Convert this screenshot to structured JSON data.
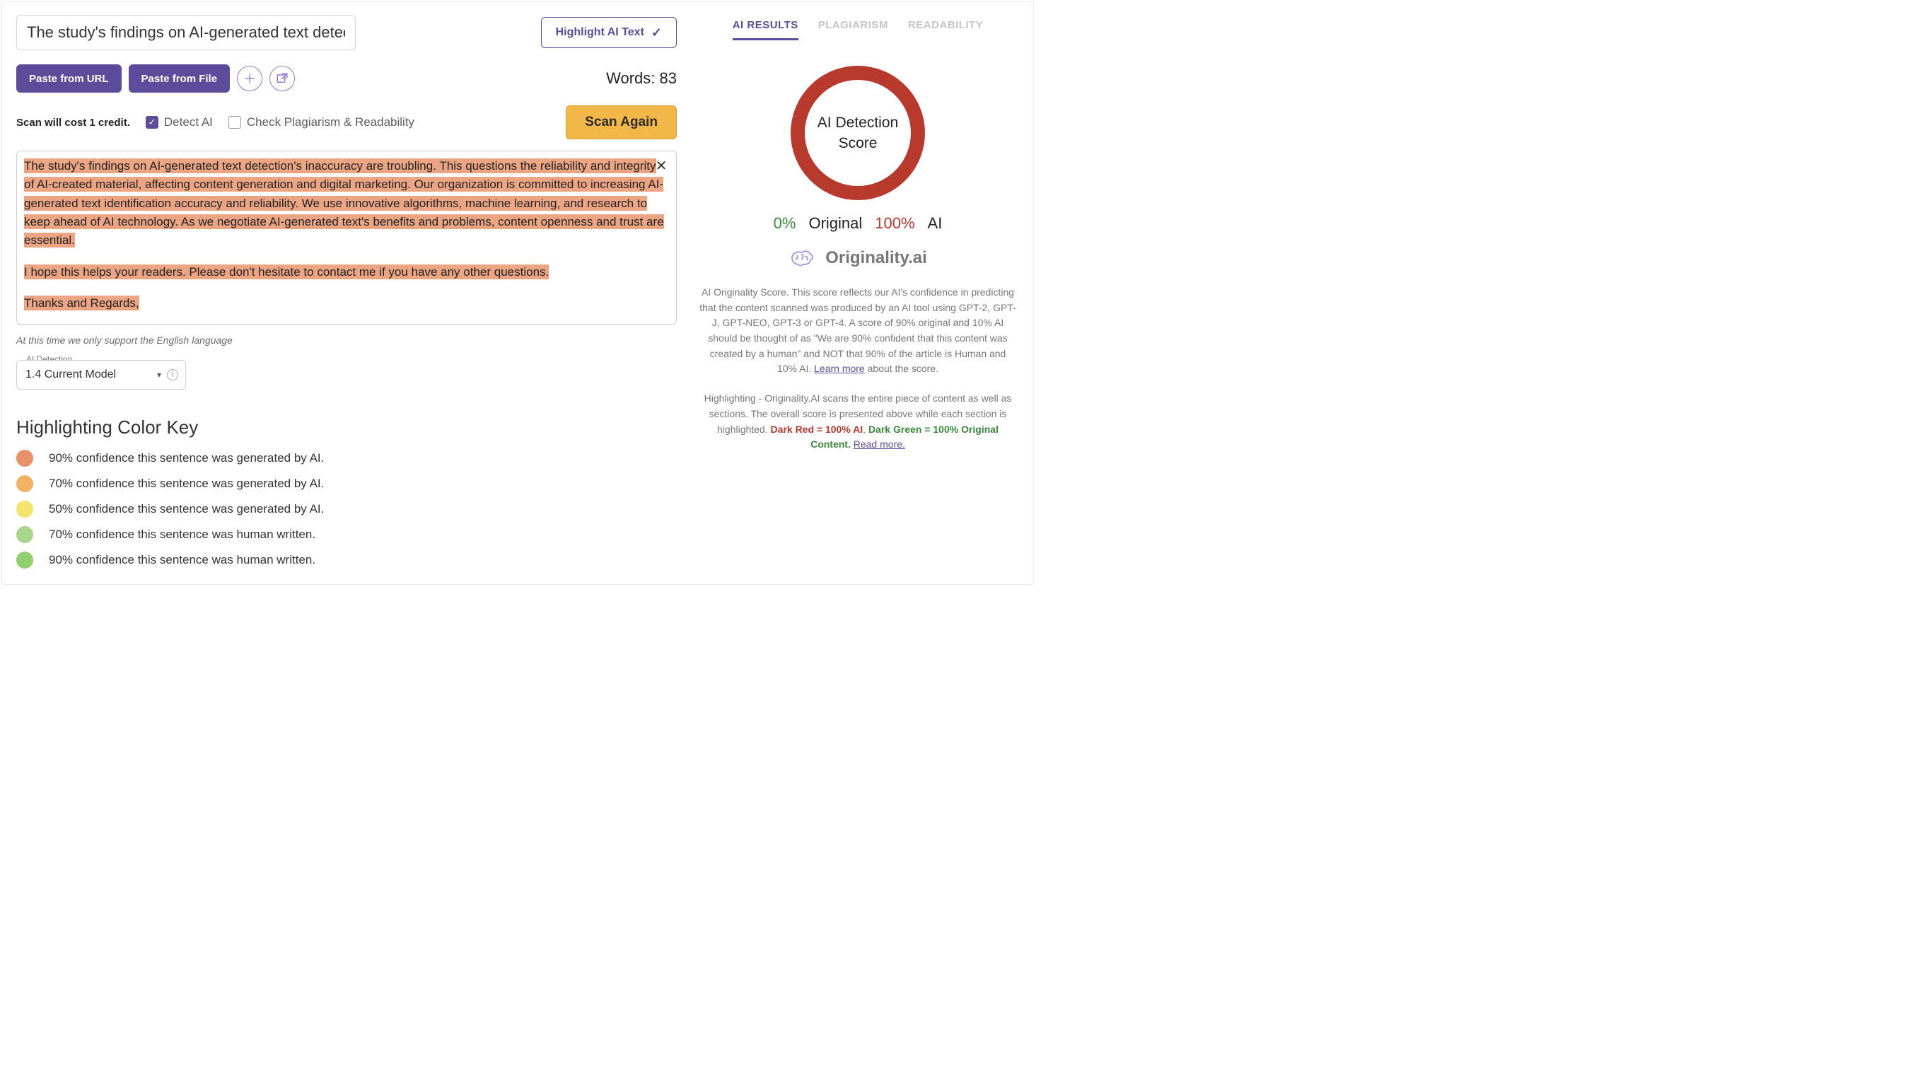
{
  "title_input": {
    "value": "The study's findings on AI-generated text detectio"
  },
  "highlight_toggle": {
    "label": "Highlight AI Text"
  },
  "toolbar": {
    "paste_url": "Paste from URL",
    "paste_file": "Paste from File"
  },
  "words": {
    "label": "Words:",
    "count": "83"
  },
  "cost_note": "Scan will cost 1 credit.",
  "options": {
    "detect_ai": "Detect AI",
    "check_plag": "Check Plagiarism & Readability"
  },
  "scan_btn": "Scan Again",
  "content": {
    "p1": "The study's findings on AI-generated text detection's inaccuracy are troubling. This questions the reliability and integrity of AI-created material, affecting content generation and digital marketing. Our organization is committed to increasing AI-generated text identification accuracy and reliability. We use innovative algorithms, machine learning, and research to keep ahead of AI technology. As we negotiate AI-generated text's benefits and problems, content openness and trust are essential.",
    "p2": "I hope this helps your readers. Please don't hesitate to contact me if you have any other questions.",
    "p3": "Thanks and Regards,"
  },
  "lang_note": "At this time we only support the English language",
  "model_select": {
    "label": "AI Detection",
    "value": "1.4 Current Model"
  },
  "color_key": {
    "title": "Highlighting Color Key",
    "items": [
      {
        "color": "sw-red",
        "text": "90% confidence this sentence was generated by AI."
      },
      {
        "color": "sw-orange",
        "text": "70% confidence this sentence was generated by AI."
      },
      {
        "color": "sw-yellow",
        "text": "50% confidence this sentence was generated by AI."
      },
      {
        "color": "sw-green-lt",
        "text": "70% confidence this sentence was human written."
      },
      {
        "color": "sw-green",
        "text": "90% confidence this sentence was human written."
      }
    ]
  },
  "tabs": {
    "ai": "AI RESULTS",
    "plag": "PLAGIARISM",
    "read": "READABILITY"
  },
  "ring_label_a": "AI Detection",
  "ring_label_b": "Score",
  "score": {
    "orig_pct": "0%",
    "orig_lbl": "Original",
    "ai_pct": "100%",
    "ai_lbl": "AI"
  },
  "brand": "Originality.ai",
  "desc": {
    "a": "AI Originality Score. This score reflects our AI's confidence in predicting that the content scanned was produced by an AI tool using GPT-2, GPT-J, GPT-NEO, GPT-3 or GPT-4. A score of 90% original and 10% AI should be thought of as \"We are 90% confident that this content was created by a human\" and NOT that 90% of the article is Human and 10% AI. ",
    "link": "Learn more",
    "b": " about the score."
  },
  "desc2": {
    "a": "Highlighting - Originality.AI scans the entire piece of content as well as sections. The overall score is presented above while each section is highlighted. ",
    "dr": "Dark Red = 100% AI",
    "sep": ", ",
    "dg": "Dark Green = 100% Original Content.",
    "sp": " ",
    "link": "Read more."
  }
}
